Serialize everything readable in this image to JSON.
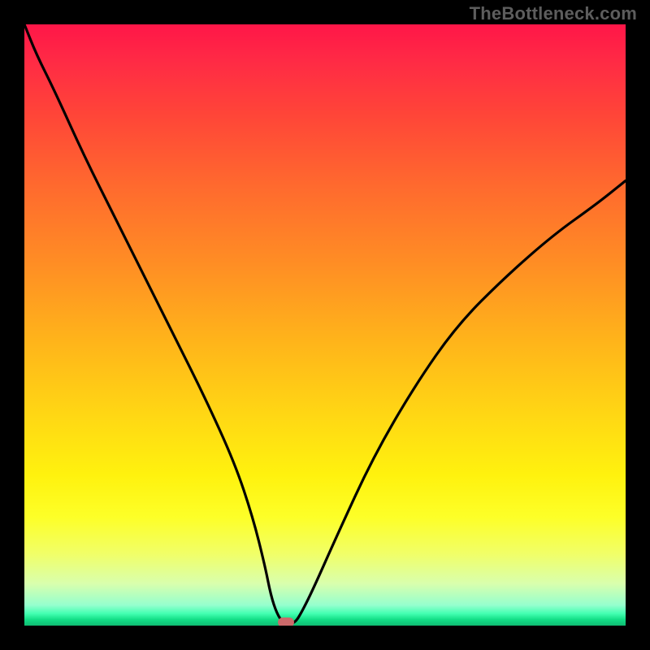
{
  "watermark_text": "TheBottleneck.com",
  "colors": {
    "frame": "#000000",
    "curve": "#000000",
    "marker": "#cc6a6b",
    "watermark": "#5d5d5d"
  },
  "chart_data": {
    "type": "line",
    "title": "",
    "xlabel": "",
    "ylabel": "",
    "xlim": [
      0,
      100
    ],
    "ylim": [
      0,
      100
    ],
    "grid": false,
    "legend": false,
    "series": [
      {
        "name": "bottleneck-curve",
        "x": [
          0,
          2,
          5,
          10,
          15,
          20,
          25,
          30,
          35,
          38,
          40,
          41,
          42,
          43,
          44,
          45,
          46,
          48,
          52,
          58,
          65,
          72,
          80,
          88,
          95,
          100
        ],
        "values": [
          100,
          95,
          89,
          78,
          68,
          58,
          48,
          38,
          27,
          18,
          10,
          5,
          2,
          0.5,
          0.3,
          0.5,
          2,
          6,
          15,
          28,
          40,
          50,
          58,
          65,
          70,
          74
        ]
      }
    ],
    "optimum_x": 43.5,
    "marker": {
      "x": 43.5,
      "y": 0.5
    },
    "gradient_stops": [
      {
        "pos": 0,
        "color": "#ff1648"
      },
      {
        "pos": 50,
        "color": "#ffc114"
      },
      {
        "pos": 82,
        "color": "#fdff28"
      },
      {
        "pos": 100,
        "color": "#0fbc72"
      }
    ]
  }
}
